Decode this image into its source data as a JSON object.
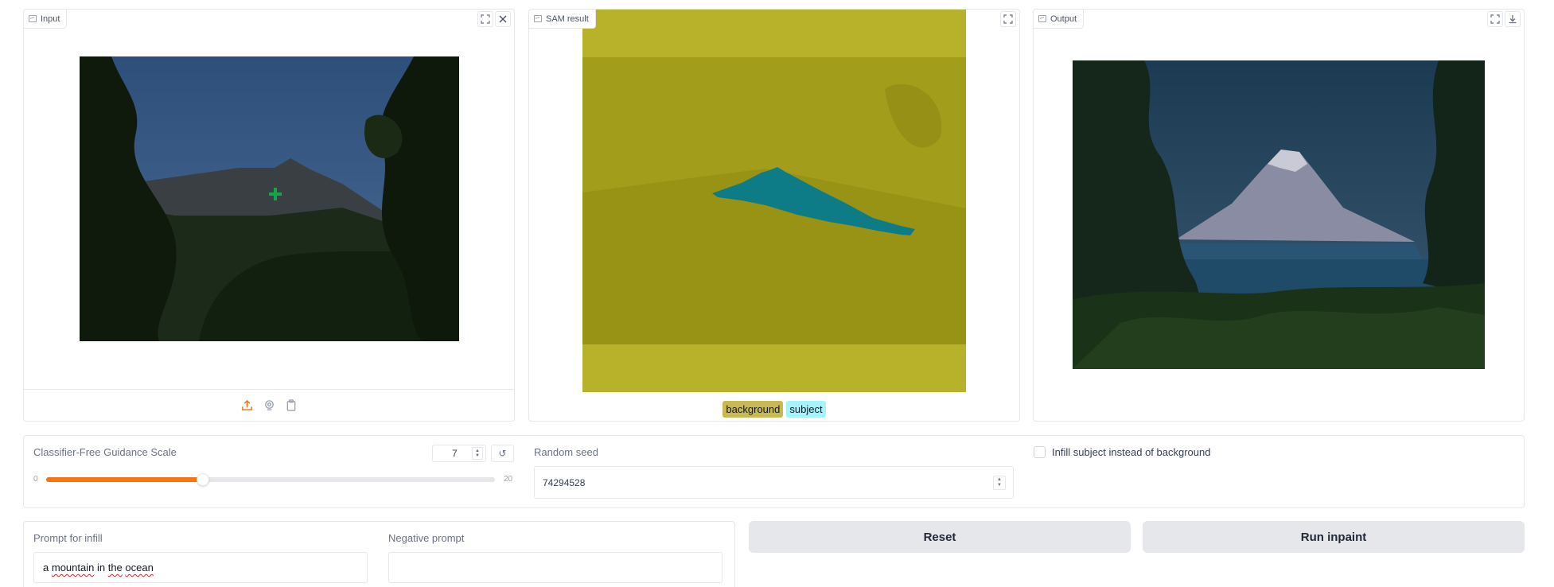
{
  "input_panel": {
    "label": "Input"
  },
  "sam_panel": {
    "label": "SAM result",
    "legend": [
      {
        "label": "background",
        "color": "#c8ba52"
      },
      {
        "label": "subject",
        "color": "#a5f3fc"
      }
    ]
  },
  "output_panel": {
    "label": "Output"
  },
  "controls": {
    "cfg_label": "Classifier-Free Guidance Scale",
    "cfg_value": "7",
    "cfg_min": "0",
    "cfg_max": "20",
    "cfg_fraction": 0.35,
    "seed_label": "Random seed",
    "seed_value": "74294528",
    "infill_label": "Infill subject instead of background",
    "infill_checked": false
  },
  "prompts": {
    "prompt_label": "Prompt for infill",
    "prompt_value_words": [
      "a",
      "mountain",
      "in",
      "the",
      "ocean"
    ],
    "negative_label": "Negative prompt",
    "negative_value": ""
  },
  "buttons": {
    "reset": "Reset",
    "run": "Run inpaint"
  },
  "colors": {
    "accent": "#f97316",
    "mask_background": "#b8b22a",
    "mask_subject": "#0e7c86",
    "point_marker": "#16a34a"
  }
}
